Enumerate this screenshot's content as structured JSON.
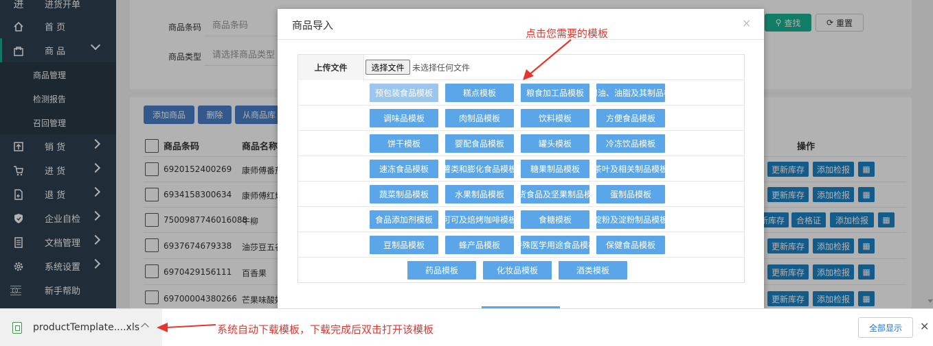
{
  "sidebar": {
    "items": [
      {
        "label": "进货开单",
        "icon": "box-icon"
      },
      {
        "label": "首 页",
        "icon": "home-icon"
      },
      {
        "label": "商 品",
        "icon": "bag-icon"
      },
      {
        "label": "销 货",
        "icon": "upload-box-icon"
      },
      {
        "label": "进 货",
        "icon": "cart-icon"
      },
      {
        "label": "退 货",
        "icon": "return-file-icon"
      },
      {
        "label": "企业自检",
        "icon": "shield-icon"
      },
      {
        "label": "文档管理",
        "icon": "document-icon"
      },
      {
        "label": "系统设置",
        "icon": "gear-icon"
      },
      {
        "label": "新手帮助",
        "icon": "help-icon"
      }
    ],
    "sub_items": [
      "商品管理",
      "检测报告",
      "召回管理"
    ]
  },
  "filters": {
    "barcode_label": "商品条码",
    "barcode_placeholder": "商品条码",
    "type_label": "商品类型",
    "type_placeholder": "请选择商品类型",
    "search_label": "查找",
    "reset_label": "重置"
  },
  "toolbar": {
    "add_label": "添加商品",
    "delete_label": "删除",
    "import_label": "从商品库"
  },
  "table": {
    "headers": [
      "商品条码",
      "商品名称",
      "操作"
    ],
    "rows": [
      {
        "barcode": "6920152400269",
        "name": "康师傅番茄"
      },
      {
        "barcode": "6934158300634",
        "name": "康师傅红烧"
      },
      {
        "barcode": "7500987746016088",
        "name": "牛柳"
      },
      {
        "barcode": "6937674679338",
        "name": "油莎豆五谷"
      },
      {
        "barcode": "6970429156111",
        "name": "百香果"
      },
      {
        "barcode": "69700004380266",
        "name": "芒果味酸奶"
      }
    ],
    "actions": {
      "update_stock": "更新库存",
      "update_stock_short": "新库存",
      "add_report": "添加检报",
      "certificate": "合格证",
      "qr": "▦"
    }
  },
  "modal": {
    "title": "商品导入",
    "close": "×",
    "upload_label": "上传文件",
    "file_button": "选择文件",
    "file_status": "未选择任何文件",
    "templates": [
      [
        "预包装食品模板",
        "糕点模板",
        "粮食加工品模板",
        "食用油、油脂及其制品模板"
      ],
      [
        "调味品模板",
        "肉制品模板",
        "饮料模板",
        "方便食品模板"
      ],
      [
        "饼干模板",
        "婴配食品模板",
        "罐头模板",
        "冷冻饮品模板"
      ],
      [
        "速冻食品模板",
        "薯类和膨化食品模板",
        "糖果制品模板",
        "茶叶及相关制品模板"
      ],
      [
        "蔬菜制品模板",
        "水果制品模板",
        "炒货食品及坚果制品模板",
        "蛋制品模板"
      ],
      [
        "食品添加剂模板",
        "可可及焙烤咖啡模板",
        "食糖模板",
        "淀粉及淀粉制品模板"
      ],
      [
        "豆制品模板",
        "蜂产品模板",
        "特殊医学用途食品模板",
        "保健食品模板"
      ],
      [
        "药品模板",
        "化妆品模板",
        "酒类模板"
      ]
    ]
  },
  "annotations": {
    "top": "点击您需要的模板",
    "bottom": "系统自动下载模板，下载完成后双击打开该模板"
  },
  "download_bar": {
    "file_name": "productTemplate....xls",
    "show_all": "全部显示",
    "close": "✕"
  },
  "colors": {
    "sidebar": "#2f4050",
    "template_button": "#5aa6e8",
    "annotation": "#e8342c",
    "search_button": "#1ab394"
  }
}
